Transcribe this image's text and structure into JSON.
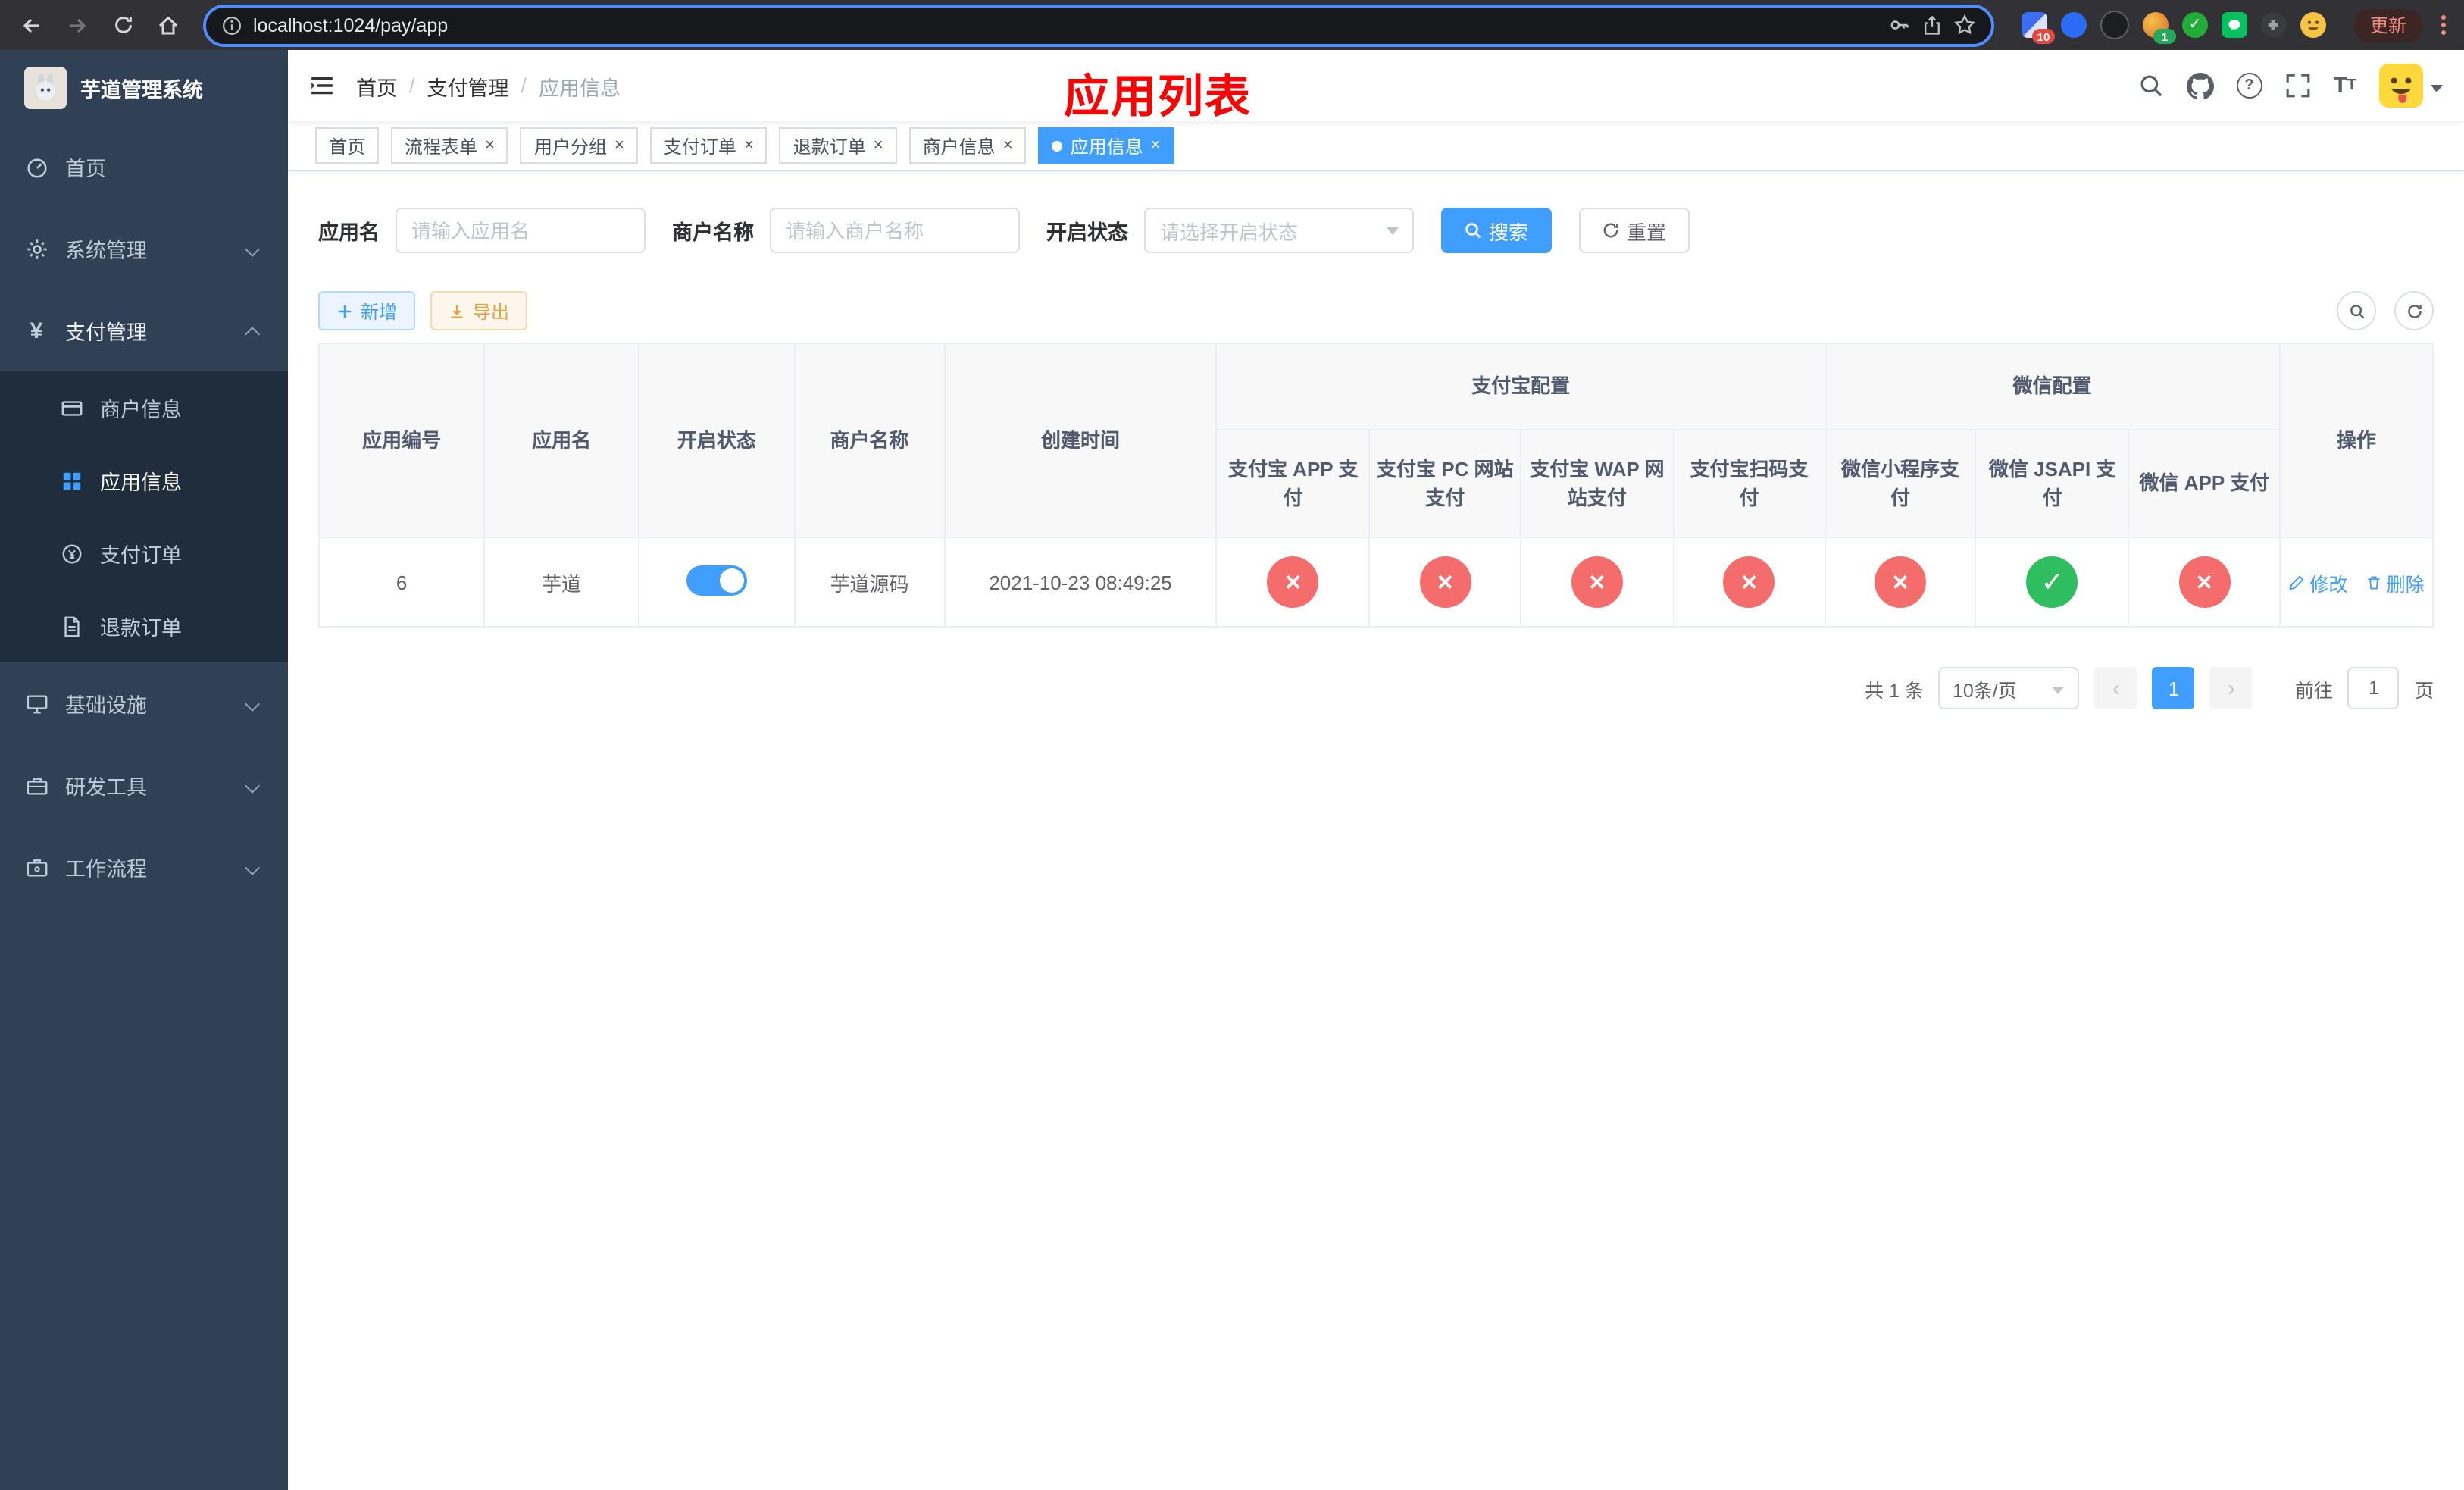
{
  "browser": {
    "url": "localhost:1024/pay/app",
    "update_label": "更新",
    "ext_badge_red": "10",
    "ext_badge_green": "1"
  },
  "sidebar": {
    "title": "芋道管理系统",
    "items": [
      {
        "label": "首页"
      },
      {
        "label": "系统管理"
      },
      {
        "label": "支付管理",
        "children": [
          {
            "label": "商户信息"
          },
          {
            "label": "应用信息"
          },
          {
            "label": "支付订单"
          },
          {
            "label": "退款订单"
          }
        ]
      },
      {
        "label": "基础设施"
      },
      {
        "label": "研发工具"
      },
      {
        "label": "工作流程"
      }
    ]
  },
  "navbar": {
    "breadcrumb": [
      "首页",
      "支付管理",
      "应用信息"
    ],
    "page_title": "应用列表"
  },
  "tags": [
    {
      "label": "首页"
    },
    {
      "label": "流程表单"
    },
    {
      "label": "用户分组"
    },
    {
      "label": "支付订单"
    },
    {
      "label": "退款订单"
    },
    {
      "label": "商户信息"
    },
    {
      "label": "应用信息"
    }
  ],
  "search": {
    "fields": [
      {
        "label": "应用名",
        "placeholder": "请输入应用名"
      },
      {
        "label": "商户名称",
        "placeholder": "请输入商户名称"
      },
      {
        "label": "开启状态",
        "placeholder": "请选择开启状态"
      }
    ],
    "search_label": "搜索",
    "reset_label": "重置"
  },
  "toolbar": {
    "add_label": "新增",
    "export_label": "导出"
  },
  "table": {
    "columns": [
      "应用编号",
      "应用名",
      "开启状态",
      "商户名称",
      "创建时间"
    ],
    "groups": {
      "alipay": "支付宝配置",
      "wechat": "微信配置"
    },
    "subcolumns": [
      "支付宝 APP 支付",
      "支付宝 PC 网站支付",
      "支付宝 WAP 网站支付",
      "支付宝扫码支付",
      "微信小程序支付",
      "微信 JSAPI 支付",
      "微信 APP 支付"
    ],
    "ops": "操作",
    "rows": [
      {
        "id": "6",
        "name": "芋道",
        "enabled": true,
        "merchant": "芋道源码",
        "created": "2021-10-23 08:49:25",
        "statuses": [
          false,
          false,
          false,
          false,
          false,
          true,
          false
        ],
        "edit": "修改",
        "delete": "删除"
      }
    ]
  },
  "pagination": {
    "total": "共 1 条",
    "size": "10条/页",
    "page": "1",
    "goto": "前往",
    "unit": "页",
    "goto_value": "1"
  }
}
